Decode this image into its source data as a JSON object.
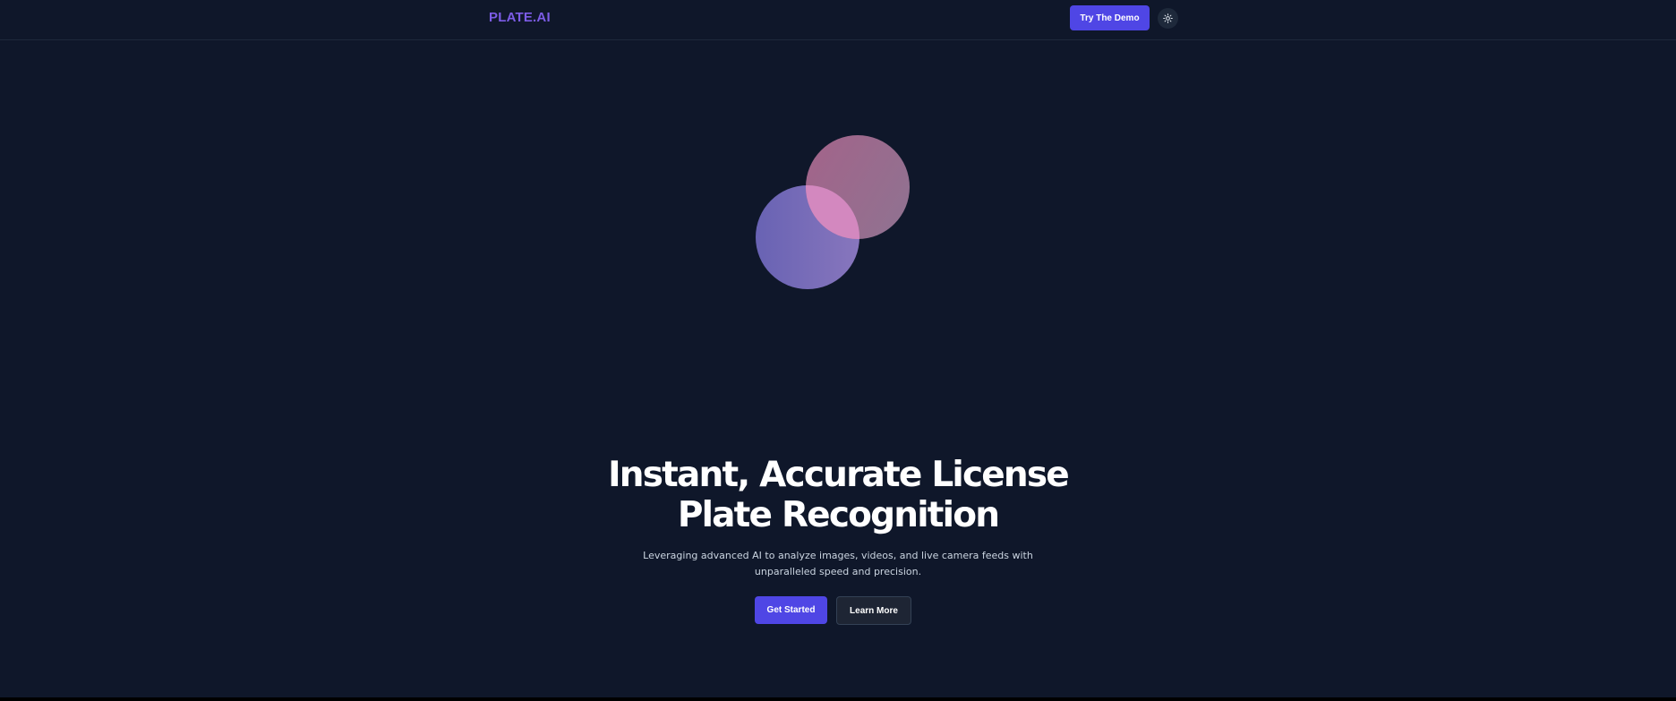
{
  "header": {
    "logo": "PLATE.AI",
    "demo_button": "Try The Demo",
    "theme_icon": "sun-icon"
  },
  "hero": {
    "title_line1": "Instant, Accurate License",
    "title_line2": "Plate Recognition",
    "subtitle_line1": "Leveraging advanced AI to analyze images, videos, and live camera feeds with",
    "subtitle_line2": "unparalleled speed and precision.",
    "primary_button": "Get Started",
    "secondary_button": "Learn More"
  },
  "colors": {
    "background": "#0f172a",
    "accent": "#4f46e5",
    "logo": "#7c5ce6"
  }
}
